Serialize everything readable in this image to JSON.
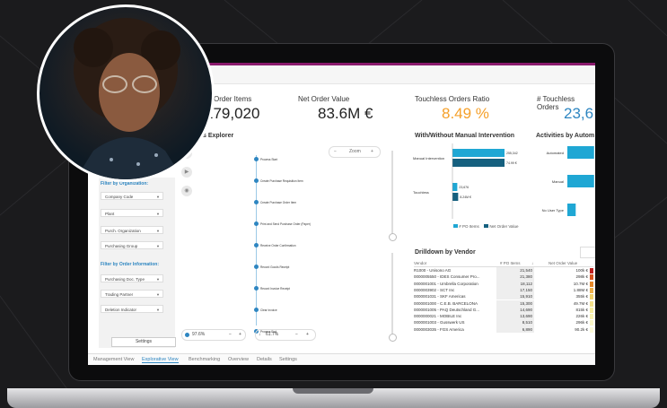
{
  "kpis": [
    {
      "label": "Order Items",
      "value": "79,020",
      "prefix": "1"
    },
    {
      "label": "Net Order Value",
      "value": "83.6M €"
    },
    {
      "label": "Touchless Orders Ratio",
      "value": "8.49 %",
      "color": "#f5a02a"
    },
    {
      "label": "# Touchless Orders",
      "value": "23,6",
      "color": "#2e86c1"
    }
  ],
  "explorer": {
    "title": "s Explorer",
    "zoom_label": "Zoom",
    "zoom_minus": "−",
    "zoom_plus": "+"
  },
  "filters": {
    "org_header": "Filter by Organization:",
    "org_items": [
      "Company Code",
      "Plant",
      "Purch. Organization",
      "Purchasing Group"
    ],
    "order_header": "Filter by Order Information:",
    "order_items": [
      "Purchasing Doc. Type",
      "Trading Partner",
      "Deletion Indicator"
    ],
    "settings": "Settings"
  },
  "flow": {
    "nodes": [
      "Process Start",
      "Create Purchase Requisition Item",
      "Create Purchase Order Item",
      "Print and Send Purchase Order (Paper)",
      "Receive Order Confirmation",
      "Record Goods Receipt",
      "Record Invoice Receipt",
      "Clear Invoice",
      "Process End"
    ]
  },
  "sliders": {
    "left_value": "97.6%",
    "right_value": "61.7%"
  },
  "manual_chart": {
    "title": "With/Without Manual Intervention",
    "legend_po": "# PO Items",
    "legend_nov": "Net Order Value",
    "colors": {
      "po": "#1fa7d4",
      "nov": "#15607f"
    }
  },
  "activities_chart": {
    "title": "Activities by Autom"
  },
  "chart_data": [
    {
      "type": "bar",
      "title": "With/Without Manual Intervention",
      "categories": [
        "Manual Intervention",
        "Touchless"
      ],
      "series": [
        {
          "name": "# PO Items",
          "values": [
            255342,
            23676
          ],
          "labels": [
            "255,342",
            "23,676"
          ]
        },
        {
          "name": "Net Order Value",
          "values": [
            74.99,
            8.24
          ],
          "labels": [
            "74.99 €",
            "8.24M €"
          ]
        }
      ]
    },
    {
      "type": "bar",
      "title": "Activities by Autom",
      "categories": [
        "Automated",
        "Manual",
        "No User Type"
      ],
      "values": [
        0.96,
        0.96,
        0.3
      ]
    }
  ],
  "drilldown": {
    "title": "Drilldown by Vendor",
    "columns": [
      "Vendor",
      "# PO Items",
      "↓",
      "Net Order Value"
    ],
    "rows": [
      [
        "R1000 - Unisono AG",
        "21,540",
        "100k €"
      ],
      [
        "0000005550 - IDES Consumer Pro...",
        "21,380",
        "298k €"
      ],
      [
        "0000001001 - Umbrella Corporation",
        "18,112",
        "10.7M €"
      ],
      [
        "0000003902 - SCT Inc",
        "17,150",
        "1.88M €"
      ],
      [
        "0000001031 - SKF Americas",
        "15,910",
        "355k €"
      ],
      [
        "0000001000 - C.E.B. BARCELONA",
        "15,300",
        "49.7M €"
      ],
      [
        "0000001005 - PAQ Deutschland G...",
        "14,690",
        "815k €"
      ],
      [
        "0000000021 - MOBILE Inc",
        "13,690",
        "226k €"
      ],
      [
        "0000001003 - Gusswerk US",
        "8,510",
        "296k €"
      ],
      [
        "0000003035 - FGS America",
        "6,890",
        "90.2k €"
      ]
    ]
  },
  "tabs": [
    "Management View",
    "Explorative View",
    "Benchmarking",
    "Overview",
    "Details",
    "Settings"
  ],
  "active_tab": 1
}
